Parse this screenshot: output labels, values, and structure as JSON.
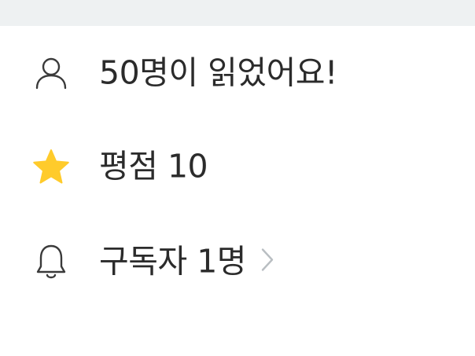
{
  "info": {
    "readers": {
      "label": "50명이 읽었어요!",
      "icon": "person-icon"
    },
    "rating": {
      "label": "평점 10",
      "icon": "star-icon",
      "icon_color": "#FFCB2B"
    },
    "subscribers": {
      "label": "구독자 1명",
      "icon": "bell-icon",
      "action_icon": "chevron-right-icon"
    }
  },
  "colors": {
    "top_bar": "#eef1f2",
    "text": "#2b2b2b",
    "icon_stroke": "#3a3a3a",
    "chevron": "#b9bec2"
  }
}
